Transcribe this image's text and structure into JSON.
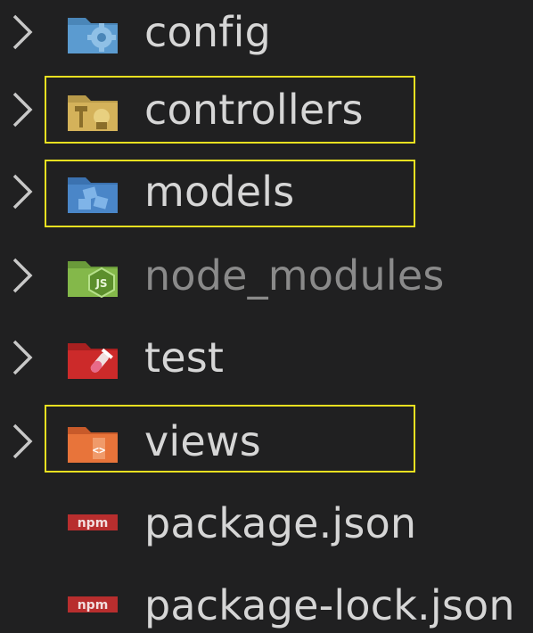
{
  "explorer": {
    "items": [
      {
        "label": "config",
        "kind": "folder",
        "icon": "config-folder-icon",
        "dim": false,
        "highlighted": false
      },
      {
        "label": "controllers",
        "kind": "folder",
        "icon": "controllers-folder-icon",
        "dim": false,
        "highlighted": true
      },
      {
        "label": "models",
        "kind": "folder",
        "icon": "models-folder-icon",
        "dim": false,
        "highlighted": true
      },
      {
        "label": "node_modules",
        "kind": "folder",
        "icon": "node-modules-folder-icon",
        "dim": true,
        "highlighted": false
      },
      {
        "label": "test",
        "kind": "folder",
        "icon": "test-folder-icon",
        "dim": false,
        "highlighted": false
      },
      {
        "label": "views",
        "kind": "folder",
        "icon": "views-folder-icon",
        "dim": false,
        "highlighted": true
      },
      {
        "label": "package.json",
        "kind": "file",
        "icon": "npm-file-icon",
        "dim": false,
        "highlighted": false
      },
      {
        "label": "package-lock.json",
        "kind": "file",
        "icon": "npm-file-icon",
        "dim": false,
        "highlighted": false
      }
    ]
  },
  "colors": {
    "background": "#202021",
    "text": "#d6d6d6",
    "dim_text": "#8a8a8a",
    "highlight_border": "#e8e020"
  }
}
